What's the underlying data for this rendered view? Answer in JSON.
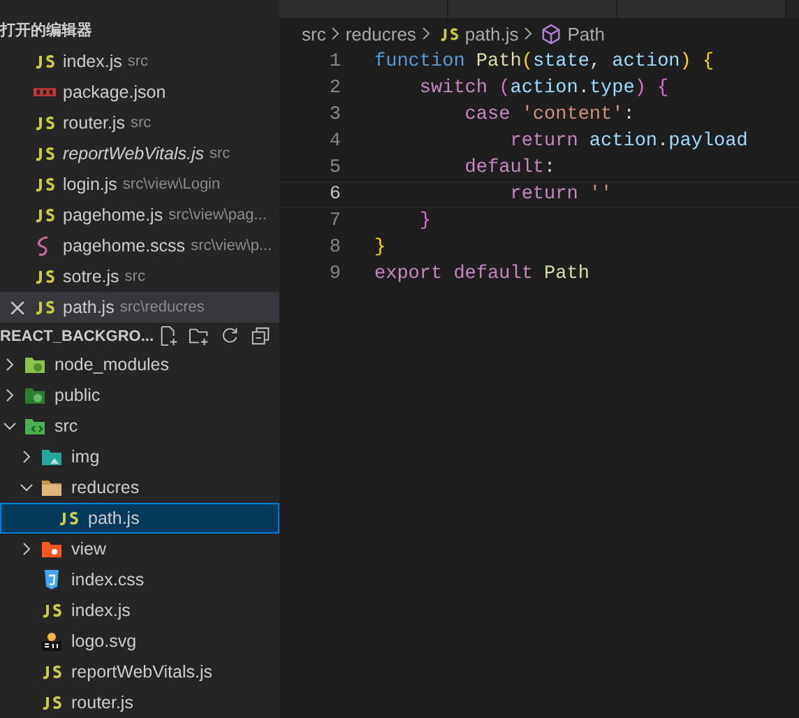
{
  "open_editors": {
    "title": "打开的编辑器",
    "items": [
      {
        "name": "index.js",
        "path": "src",
        "kind": "js",
        "preview": false,
        "active": false
      },
      {
        "name": "package.json",
        "kind": "npm",
        "preview": false,
        "active": false
      },
      {
        "name": "router.js",
        "path": "src",
        "kind": "js",
        "preview": false,
        "active": false
      },
      {
        "name": "reportWebVitals.js",
        "path": "src",
        "kind": "js",
        "preview": true,
        "active": false
      },
      {
        "name": "login.js",
        "path": "src\\view\\Login",
        "kind": "js",
        "preview": false,
        "active": false
      },
      {
        "name": "pagehome.js",
        "path": "src\\view\\pag...",
        "kind": "js",
        "preview": false,
        "active": false
      },
      {
        "name": "pagehome.scss",
        "path": "src\\view\\p...",
        "kind": "sass",
        "preview": false,
        "active": false
      },
      {
        "name": "sotre.js",
        "path": "src",
        "kind": "js",
        "preview": false,
        "active": false
      },
      {
        "name": "path.js",
        "path": "src\\reducres",
        "kind": "js",
        "preview": false,
        "active": true
      }
    ]
  },
  "explorer": {
    "title": "REACT_BACKGRO...",
    "tree": [
      {
        "name": "node_modules",
        "kind": "folder-node",
        "expanded": false,
        "selected": false
      },
      {
        "name": "public",
        "kind": "folder-public",
        "expanded": false,
        "selected": false
      },
      {
        "name": "src",
        "kind": "folder-src",
        "expanded": true,
        "selected": false,
        "children": [
          {
            "name": "img",
            "kind": "folder-img",
            "expanded": false,
            "selected": false
          },
          {
            "name": "reducres",
            "kind": "folder",
            "expanded": true,
            "selected": false,
            "children": [
              {
                "name": "path.js",
                "kind": "js",
                "selected": true
              }
            ]
          },
          {
            "name": "view",
            "kind": "folder-view",
            "expanded": false,
            "selected": false
          },
          {
            "name": "index.css",
            "kind": "css",
            "selected": false
          },
          {
            "name": "index.js",
            "kind": "js",
            "selected": false
          },
          {
            "name": "logo.svg",
            "kind": "svg",
            "selected": false
          },
          {
            "name": "reportWebVitals.js",
            "kind": "js",
            "selected": false
          },
          {
            "name": "router.js",
            "kind": "js",
            "selected": false
          }
        ]
      }
    ]
  },
  "breadcrumbs": [
    {
      "label": "src",
      "kind": "folder"
    },
    {
      "label": "reducres",
      "kind": "folder"
    },
    {
      "label": "path.js",
      "kind": "js"
    },
    {
      "label": "Path",
      "kind": "symbol"
    }
  ],
  "code": [
    {
      "number": "1",
      "current": false,
      "tokens": [
        {
          "kind": "keyword",
          "text": "function"
        },
        {
          "kind": "func",
          "text": " Path"
        },
        {
          "kind": "bracket1",
          "text": "("
        },
        {
          "kind": "var",
          "text": "state"
        },
        {
          "kind": "plain",
          "text": ","
        },
        {
          "kind": "var",
          "text": " action"
        },
        {
          "kind": "bracket1",
          "text": ")"
        },
        {
          "kind": "bracket1",
          "text": " {"
        }
      ]
    },
    {
      "number": "2",
      "current": false,
      "tokens": [
        {
          "kind": "control",
          "text": "    switch"
        },
        {
          "kind": "bracket2",
          "text": " ("
        },
        {
          "kind": "var",
          "text": "action"
        },
        {
          "kind": "plain",
          "text": "."
        },
        {
          "kind": "var",
          "text": "type"
        },
        {
          "kind": "bracket2",
          "text": ")"
        },
        {
          "kind": "bracket2",
          "text": " {"
        }
      ]
    },
    {
      "number": "3",
      "current": false,
      "tokens": [
        {
          "kind": "control",
          "text": "        case"
        },
        {
          "kind": "string",
          "text": " 'content'"
        },
        {
          "kind": "plain",
          "text": ":"
        }
      ]
    },
    {
      "number": "4",
      "current": false,
      "tokens": [
        {
          "kind": "control",
          "text": "            return"
        },
        {
          "kind": "var",
          "text": " action"
        },
        {
          "kind": "plain",
          "text": "."
        },
        {
          "kind": "var",
          "text": "payload"
        }
      ]
    },
    {
      "number": "5",
      "current": false,
      "tokens": [
        {
          "kind": "control",
          "text": "        default"
        },
        {
          "kind": "plain",
          "text": ":"
        }
      ]
    },
    {
      "number": "6",
      "current": true,
      "tokens": [
        {
          "kind": "control",
          "text": "            return"
        },
        {
          "kind": "string",
          "text": " ''"
        }
      ]
    },
    {
      "number": "7",
      "current": false,
      "tokens": [
        {
          "kind": "bracket2",
          "text": "    }"
        }
      ]
    },
    {
      "number": "8",
      "current": false,
      "tokens": [
        {
          "kind": "bracket1",
          "text": "}"
        }
      ]
    },
    {
      "number": "9",
      "current": false,
      "tokens": [
        {
          "kind": "control",
          "text": "export"
        },
        {
          "kind": "control",
          "text": " default"
        },
        {
          "kind": "func",
          "text": " Path"
        }
      ]
    }
  ]
}
